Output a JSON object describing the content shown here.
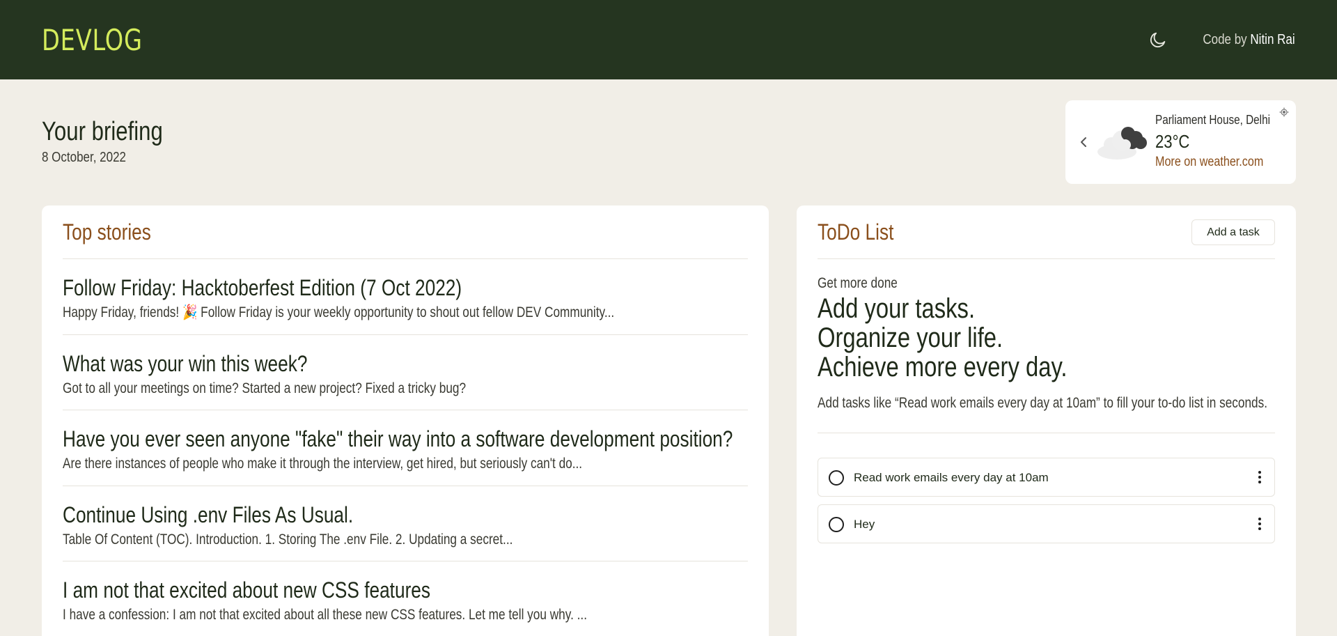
{
  "header": {
    "logo": "DEVLOG",
    "credit_prefix": "Code by",
    "credit_name": "Nitin Rai",
    "theme_icon": "moon-icon"
  },
  "briefing": {
    "title": "Your briefing",
    "date": "8 October, 2022"
  },
  "weather": {
    "location": "Parliament House, Delhi",
    "temperature": "23°C",
    "link": "More on weather.com",
    "condition_icon": "cloudy-icon"
  },
  "stories": {
    "title": "Top stories",
    "items": [
      {
        "title": "Follow Friday: Hacktoberfest Edition (7 Oct 2022)",
        "desc": "Happy Friday, friends! 🎉 Follow Friday is your weekly opportunity to shout out fellow DEV Community..."
      },
      {
        "title": "What was your win this week?",
        "desc": "Got to all your meetings on time? Started a new project? Fixed a tricky bug?"
      },
      {
        "title": "Have you ever seen anyone \"fake\" their way into a software development position?",
        "desc": "Are there instances of people who make it through the interview, get hired, but seriously can't do..."
      },
      {
        "title": "Continue Using .env Files As Usual.",
        "desc": "Table Of Content (TOC). Introduction. 1. Storing The .env File. 2. Updating a secret..."
      },
      {
        "title": "I am not that excited about new CSS features",
        "desc": "I have a confession: I am not that excited about all these new CSS features. Let me tell you why. ..."
      }
    ]
  },
  "todo": {
    "title": "ToDo List",
    "add_label": "Add a task",
    "kicker": "Get more done",
    "headline1": "Add your tasks.",
    "headline2": "Organize your life.",
    "headline3": "Achieve more every day.",
    "hint": "Add tasks like “Read work emails every day at 10am” to fill your to-do list in seconds.",
    "tasks": [
      {
        "text": "Read work emails every day at 10am"
      },
      {
        "text": "Hey"
      }
    ]
  },
  "colors": {
    "header_bg": "#253520",
    "logo": "#d4ec5c",
    "accent": "#8a4f1c",
    "page_bg": "#f1eee7"
  }
}
